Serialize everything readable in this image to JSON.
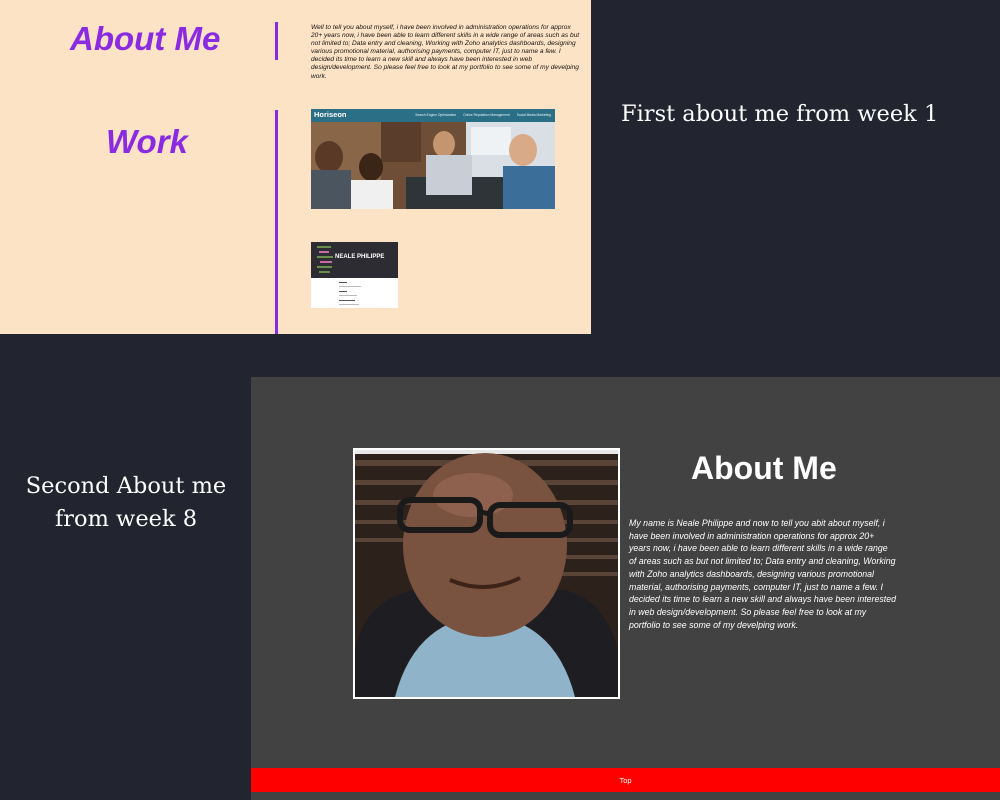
{
  "week1": {
    "about_heading": "About Me",
    "work_heading": "Work",
    "about_text": "Well to tell you about myself, i have been involved in administration operations for approx 20+ years now, i have been able to learn different skills in a wide range of areas such as but not limited to; Data entry and cleaning, Working with Zoho analytics dashboards, designing various promotional material, authorising payments, computer IT, just to name a few. I decided its time to learn a new skill and always have been interested in web design/development. So please feel free to look at my portfolio to see some of my develping work.",
    "horiseon": {
      "logo": "Horiseon",
      "nav": [
        "Search Engine Optimization",
        "Online Reputation Management",
        "Social Media Marketing"
      ]
    },
    "portfolio_thumb": {
      "name": "NEALE PHILIPPE"
    },
    "accent_color": "#8a2be2",
    "background_color": "#fde3c5"
  },
  "captions": {
    "first": "First about me from week 1",
    "second": "Second About me from week 8"
  },
  "week8": {
    "title": "About Me",
    "bio": "My name is Neale Philippe and now to tell you abit about myself, i have been involved in administration operations for approx 20+ years now, i have been able to learn different skills in a wide range of areas such as but not limited to; Data entry and cleaning, Working with Zoho analytics dashboards, designing various promotional material, authorising payments, computer IT, just to name a few. I decided its time to learn a new skill and always have been interested in web design/development. So please feel free to look at my portfolio to see some of my develping work.",
    "top_link": "Top",
    "background_color": "#424242",
    "footer_color": "#fe0000"
  }
}
